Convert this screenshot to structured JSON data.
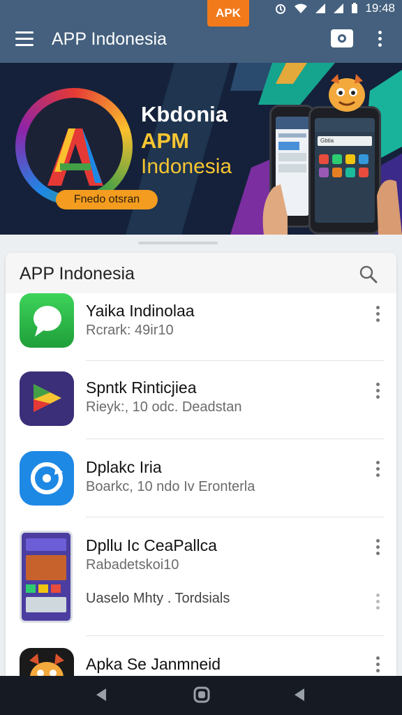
{
  "status_bar": {
    "badge": "APK",
    "time": "19:48"
  },
  "app_bar": {
    "title": "APP Indonesia"
  },
  "banner": {
    "line1": "Kbdonia",
    "line2": "APM",
    "line3": "Indonesia",
    "pill": "Fnedo otsran",
    "phone_search": "Gbtia"
  },
  "list": {
    "title": "APP Indonesia",
    "items": [
      {
        "name": "Yaika Indinolaa",
        "sub": "Rcrark: 49ir10"
      },
      {
        "name": "Spntk Rinticjiea",
        "sub": "Rieyk:, 10 odc. Deadstan"
      },
      {
        "name": "Dplakc Iria",
        "sub": "Boarkc, 10 ndo Iv Eronterla"
      },
      {
        "name": "Dpllu Ic CeaPallca",
        "sub": "Rabadetskoi10",
        "sub2": "Uaselo Mhty . Tordsials"
      },
      {
        "name": "Apka Se Janmneid"
      }
    ]
  },
  "colors": {
    "app_bar": "#44607e",
    "accent": "#f27a1a",
    "banner_bg": "#15213a",
    "banner_text_yellow": "#f6c531"
  }
}
